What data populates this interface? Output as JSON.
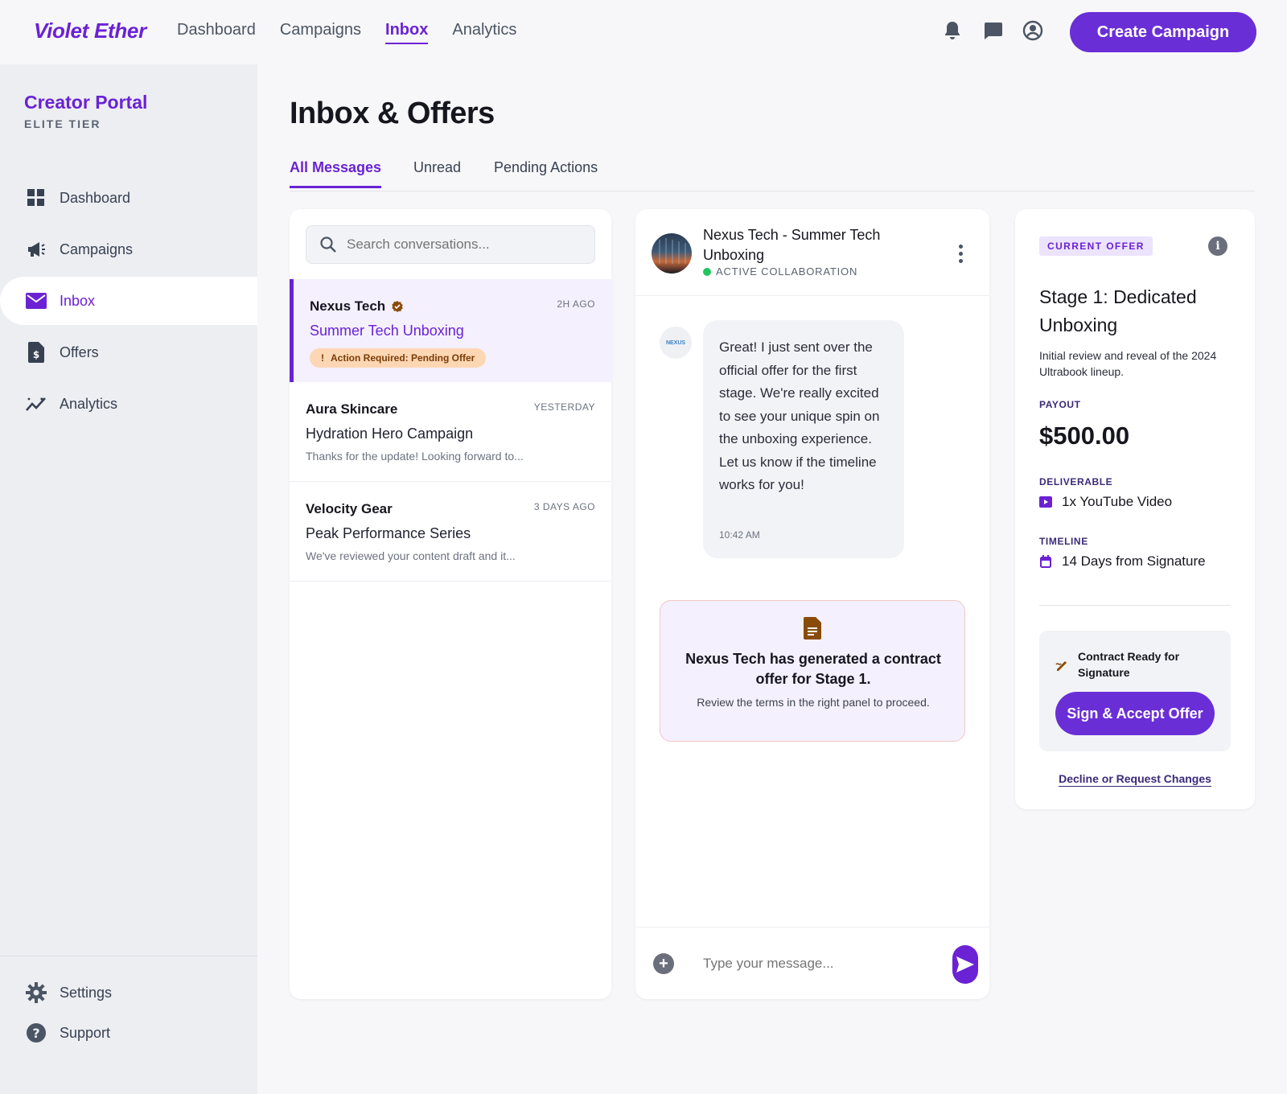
{
  "topbar": {
    "brand": "Violet Ether",
    "nav": [
      "Dashboard",
      "Campaigns",
      "Inbox",
      "Analytics"
    ],
    "active_nav": "Inbox",
    "icons": [
      "bell-icon",
      "chat-icon",
      "account-icon"
    ],
    "create_button": "Create Campaign"
  },
  "sidebar": {
    "title": "Creator Portal",
    "tier": "ELITE TIER",
    "items": [
      {
        "label": "Dashboard",
        "icon": "grid-icon"
      },
      {
        "label": "Campaigns",
        "icon": "megaphone-icon"
      },
      {
        "label": "Inbox",
        "icon": "mail-icon",
        "active": true
      },
      {
        "label": "Offers",
        "icon": "invoice-icon"
      },
      {
        "label": "Analytics",
        "icon": "trend-icon"
      }
    ],
    "footer": [
      {
        "label": "Settings",
        "icon": "gear-icon"
      },
      {
        "label": "Support",
        "icon": "help-icon"
      }
    ]
  },
  "main": {
    "title": "Inbox & Offers",
    "tabs": [
      "All Messages",
      "Unread",
      "Pending Actions"
    ],
    "active_tab": "All Messages"
  },
  "conversations": {
    "search_placeholder": "Search conversations...",
    "items": [
      {
        "brand": "Nexus Tech",
        "verified": true,
        "time": "2H AGO",
        "campaign": "Summer Tech Unboxing",
        "badge": "Action Required: Pending Offer",
        "active": true
      },
      {
        "brand": "Aura Skincare",
        "time": "YESTERDAY",
        "campaign": "Hydration Hero Campaign",
        "preview": "Thanks for the update! Looking forward to..."
      },
      {
        "brand": "Velocity Gear",
        "time": "3 DAYS AGO",
        "campaign": "Peak Performance Series",
        "preview": "We've reviewed your content draft and it..."
      }
    ]
  },
  "chat": {
    "title": "Nexus Tech - Summer Tech Unboxing",
    "status": "ACTIVE COLLABORATION",
    "avatar_label": "NEXUS",
    "message": {
      "text": "Great! I just sent over the official offer for the first stage. We're really excited to see your unique spin on the unboxing experience. Let us know if the timeline works for you!",
      "time": "10:42 AM"
    },
    "notice": {
      "title": "Nexus Tech has generated a contract offer for Stage 1.",
      "subtitle": "Review the terms in the right panel to proceed."
    },
    "composer_placeholder": "Type your message..."
  },
  "offer": {
    "tag": "CURRENT OFFER",
    "title": "Stage 1: Dedicated Unboxing",
    "description": "Initial review and reveal of the 2024 Ultrabook lineup.",
    "payout_label": "PAYOUT",
    "payout": "$500.00",
    "deliverable_label": "DELIVERABLE",
    "deliverable": "1x YouTube Video",
    "timeline_label": "TIMELINE",
    "timeline": "14 Days from Signature",
    "signature_title": "Contract Ready for Signature",
    "sign_button": "Sign & Accept Offer",
    "decline_link": "Decline or Request Changes"
  },
  "colors": {
    "accent": "#6a22d4",
    "button": "#6a2ed6",
    "active_bg": "#f4f0fe",
    "warn_pill": "#fdd7b4",
    "status_green": "#22c55e"
  }
}
